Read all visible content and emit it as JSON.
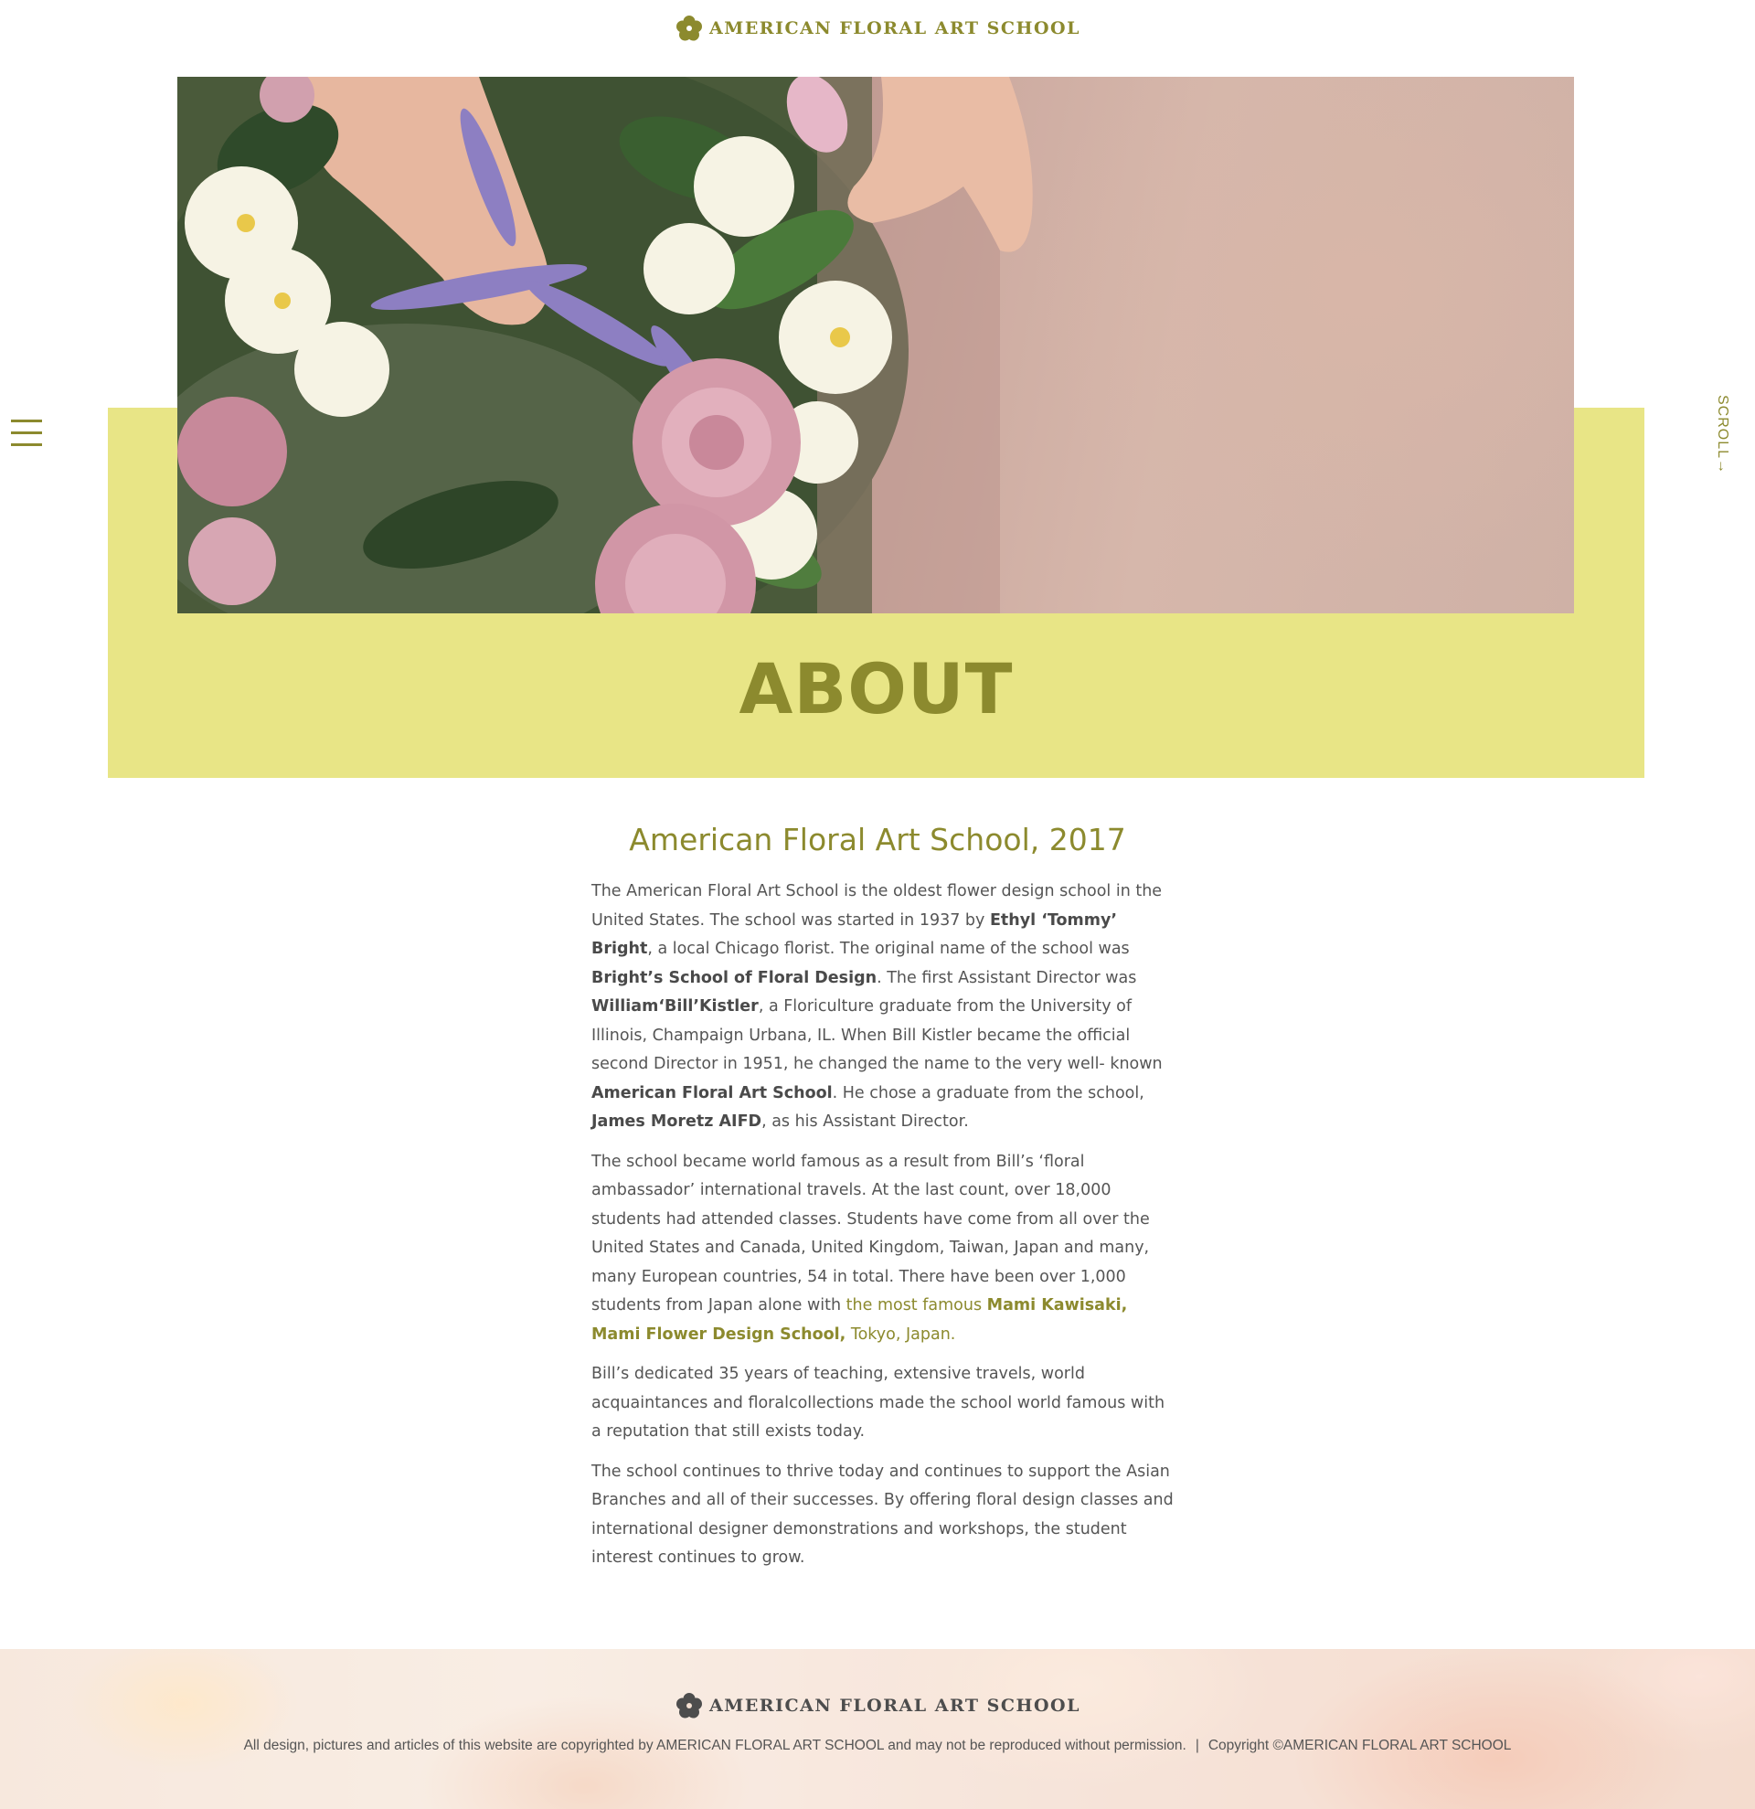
{
  "brand": {
    "name": "AMERICAN FLORAL ART SCHOOL",
    "color": "#8c8a2e"
  },
  "nav": {
    "menu_icon": "hamburger-menu-icon",
    "scroll_label": "SCROLL→"
  },
  "hero": {
    "image": "flower-arrangement-photo",
    "band_color": "#e8e586",
    "title": "ABOUT"
  },
  "article": {
    "heading": "American Floral Art School, 2017",
    "p1": {
      "t1": "The American Floral Art School is the oldest flower design school in the United States. The school was started in 1937 by ",
      "b1": "Ethyl  ‘Tommy’ Bright",
      "t2": ", a local Chicago florist.  The original name of the school was ",
      "b2": "Bright’s School of Floral Design",
      "t3": ". The first Assistant Director was ",
      "b3": "William‘Bill’Kistler",
      "t4": ", a Floriculture graduate from the University of Illinois, Champaign Urbana, IL. When Bill Kistler became the official second Director in 1951, he changed the name to the very well- known ",
      "b4": "American Floral Art School",
      "t5": ". He chose a graduate from the school, ",
      "b5": "James Moretz AIFD",
      "t6": ", as his Assistant Director."
    },
    "p2": {
      "t1": "The school became world famous as a result from Bill’s ‘floral ambassador’ international travels. At the last count, over 18,000 students had attended classes. Students have come from all over the United States and Canada, United Kingdom, Taiwan, Japan and many, many European countries, 54 in total. There have been over 1,000 students from Japan alone with ",
      "h1": "the most famous ",
      "hb": "Mami Kawisaki, Mami Flower Design School,",
      "h2": " Tokyo, Japan."
    },
    "p3": "Bill’s dedicated 35 years of teaching, extensive travels, world acquaintances and floralcollections made the school world famous with a reputation that still exists today.",
    "p4": "The school continues to thrive today and continues to support the Asian Branches and all of their successes. By offering floral design classes and international designer demonstrations and workshops, the student interest continues to grow."
  },
  "footer": {
    "brand_name": "AMERICAN FLORAL ART SCHOOL",
    "rights": "All design, pictures and articles of this website are copyrighted by AMERICAN FLORAL ART SCHOOL and may not be reproduced without permission.",
    "separator": "|",
    "copyright": "Copyright ©AMERICAN FLORAL ART SCHOOL"
  }
}
